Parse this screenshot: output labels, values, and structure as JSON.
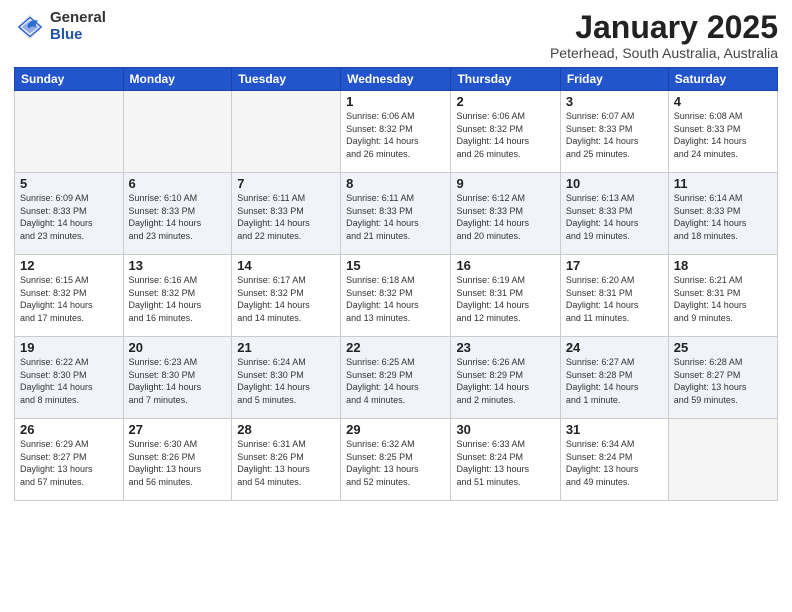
{
  "header": {
    "logo_general": "General",
    "logo_blue": "Blue",
    "month": "January 2025",
    "location": "Peterhead, South Australia, Australia"
  },
  "weekdays": [
    "Sunday",
    "Monday",
    "Tuesday",
    "Wednesday",
    "Thursday",
    "Friday",
    "Saturday"
  ],
  "weeks": [
    [
      {
        "day": "",
        "info": ""
      },
      {
        "day": "",
        "info": ""
      },
      {
        "day": "",
        "info": ""
      },
      {
        "day": "1",
        "info": "Sunrise: 6:06 AM\nSunset: 8:32 PM\nDaylight: 14 hours\nand 26 minutes."
      },
      {
        "day": "2",
        "info": "Sunrise: 6:06 AM\nSunset: 8:32 PM\nDaylight: 14 hours\nand 26 minutes."
      },
      {
        "day": "3",
        "info": "Sunrise: 6:07 AM\nSunset: 8:33 PM\nDaylight: 14 hours\nand 25 minutes."
      },
      {
        "day": "4",
        "info": "Sunrise: 6:08 AM\nSunset: 8:33 PM\nDaylight: 14 hours\nand 24 minutes."
      }
    ],
    [
      {
        "day": "5",
        "info": "Sunrise: 6:09 AM\nSunset: 8:33 PM\nDaylight: 14 hours\nand 23 minutes."
      },
      {
        "day": "6",
        "info": "Sunrise: 6:10 AM\nSunset: 8:33 PM\nDaylight: 14 hours\nand 23 minutes."
      },
      {
        "day": "7",
        "info": "Sunrise: 6:11 AM\nSunset: 8:33 PM\nDaylight: 14 hours\nand 22 minutes."
      },
      {
        "day": "8",
        "info": "Sunrise: 6:11 AM\nSunset: 8:33 PM\nDaylight: 14 hours\nand 21 minutes."
      },
      {
        "day": "9",
        "info": "Sunrise: 6:12 AM\nSunset: 8:33 PM\nDaylight: 14 hours\nand 20 minutes."
      },
      {
        "day": "10",
        "info": "Sunrise: 6:13 AM\nSunset: 8:33 PM\nDaylight: 14 hours\nand 19 minutes."
      },
      {
        "day": "11",
        "info": "Sunrise: 6:14 AM\nSunset: 8:33 PM\nDaylight: 14 hours\nand 18 minutes."
      }
    ],
    [
      {
        "day": "12",
        "info": "Sunrise: 6:15 AM\nSunset: 8:32 PM\nDaylight: 14 hours\nand 17 minutes."
      },
      {
        "day": "13",
        "info": "Sunrise: 6:16 AM\nSunset: 8:32 PM\nDaylight: 14 hours\nand 16 minutes."
      },
      {
        "day": "14",
        "info": "Sunrise: 6:17 AM\nSunset: 8:32 PM\nDaylight: 14 hours\nand 14 minutes."
      },
      {
        "day": "15",
        "info": "Sunrise: 6:18 AM\nSunset: 8:32 PM\nDaylight: 14 hours\nand 13 minutes."
      },
      {
        "day": "16",
        "info": "Sunrise: 6:19 AM\nSunset: 8:31 PM\nDaylight: 14 hours\nand 12 minutes."
      },
      {
        "day": "17",
        "info": "Sunrise: 6:20 AM\nSunset: 8:31 PM\nDaylight: 14 hours\nand 11 minutes."
      },
      {
        "day": "18",
        "info": "Sunrise: 6:21 AM\nSunset: 8:31 PM\nDaylight: 14 hours\nand 9 minutes."
      }
    ],
    [
      {
        "day": "19",
        "info": "Sunrise: 6:22 AM\nSunset: 8:30 PM\nDaylight: 14 hours\nand 8 minutes."
      },
      {
        "day": "20",
        "info": "Sunrise: 6:23 AM\nSunset: 8:30 PM\nDaylight: 14 hours\nand 7 minutes."
      },
      {
        "day": "21",
        "info": "Sunrise: 6:24 AM\nSunset: 8:30 PM\nDaylight: 14 hours\nand 5 minutes."
      },
      {
        "day": "22",
        "info": "Sunrise: 6:25 AM\nSunset: 8:29 PM\nDaylight: 14 hours\nand 4 minutes."
      },
      {
        "day": "23",
        "info": "Sunrise: 6:26 AM\nSunset: 8:29 PM\nDaylight: 14 hours\nand 2 minutes."
      },
      {
        "day": "24",
        "info": "Sunrise: 6:27 AM\nSunset: 8:28 PM\nDaylight: 14 hours\nand 1 minute."
      },
      {
        "day": "25",
        "info": "Sunrise: 6:28 AM\nSunset: 8:27 PM\nDaylight: 13 hours\nand 59 minutes."
      }
    ],
    [
      {
        "day": "26",
        "info": "Sunrise: 6:29 AM\nSunset: 8:27 PM\nDaylight: 13 hours\nand 57 minutes."
      },
      {
        "day": "27",
        "info": "Sunrise: 6:30 AM\nSunset: 8:26 PM\nDaylight: 13 hours\nand 56 minutes."
      },
      {
        "day": "28",
        "info": "Sunrise: 6:31 AM\nSunset: 8:26 PM\nDaylight: 13 hours\nand 54 minutes."
      },
      {
        "day": "29",
        "info": "Sunrise: 6:32 AM\nSunset: 8:25 PM\nDaylight: 13 hours\nand 52 minutes."
      },
      {
        "day": "30",
        "info": "Sunrise: 6:33 AM\nSunset: 8:24 PM\nDaylight: 13 hours\nand 51 minutes."
      },
      {
        "day": "31",
        "info": "Sunrise: 6:34 AM\nSunset: 8:24 PM\nDaylight: 13 hours\nand 49 minutes."
      },
      {
        "day": "",
        "info": ""
      }
    ]
  ]
}
